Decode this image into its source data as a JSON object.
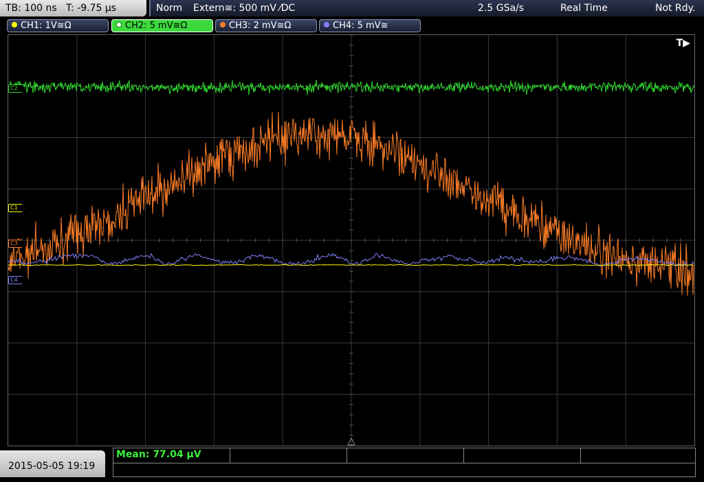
{
  "header": {
    "timebase": "TB: 100 ns",
    "trigger_time": "T: -9.75 µs",
    "mode": "Norm",
    "trigger_source": "Extern≅: 500 mV ⁄DC",
    "sample_rate": "2.5 GSa/s",
    "acq_mode": "Real Time",
    "state": "Not Rdy."
  },
  "channels": [
    {
      "label": "CH1: 1V≅Ω",
      "color": "#ffff00",
      "active": false
    },
    {
      "label": "CH2: 5 mV≅Ω",
      "color": "#2edc2e",
      "active": true
    },
    {
      "label": "CH3: 2 mV≅Ω",
      "color": "#ff7f27",
      "active": false
    },
    {
      "label": "CH4: 5 mV≅",
      "color": "#8080ff",
      "active": false
    }
  ],
  "markers": {
    "c1": "C1",
    "c2": "C2",
    "c3": "C3",
    "c4": "C4",
    "trigger": "T▶"
  },
  "waveforms": {
    "ch1": {
      "description_level_div": 0.0,
      "color": "#ffff00"
    },
    "ch2": {
      "color": "#2edc2e"
    },
    "ch3": {
      "color": "#ff7f27"
    },
    "ch4": {
      "color": "#8080ff"
    }
  },
  "footer": {
    "datetime": "2015-05-05 19:19",
    "measurement": "Mean: 77.04 µV"
  }
}
